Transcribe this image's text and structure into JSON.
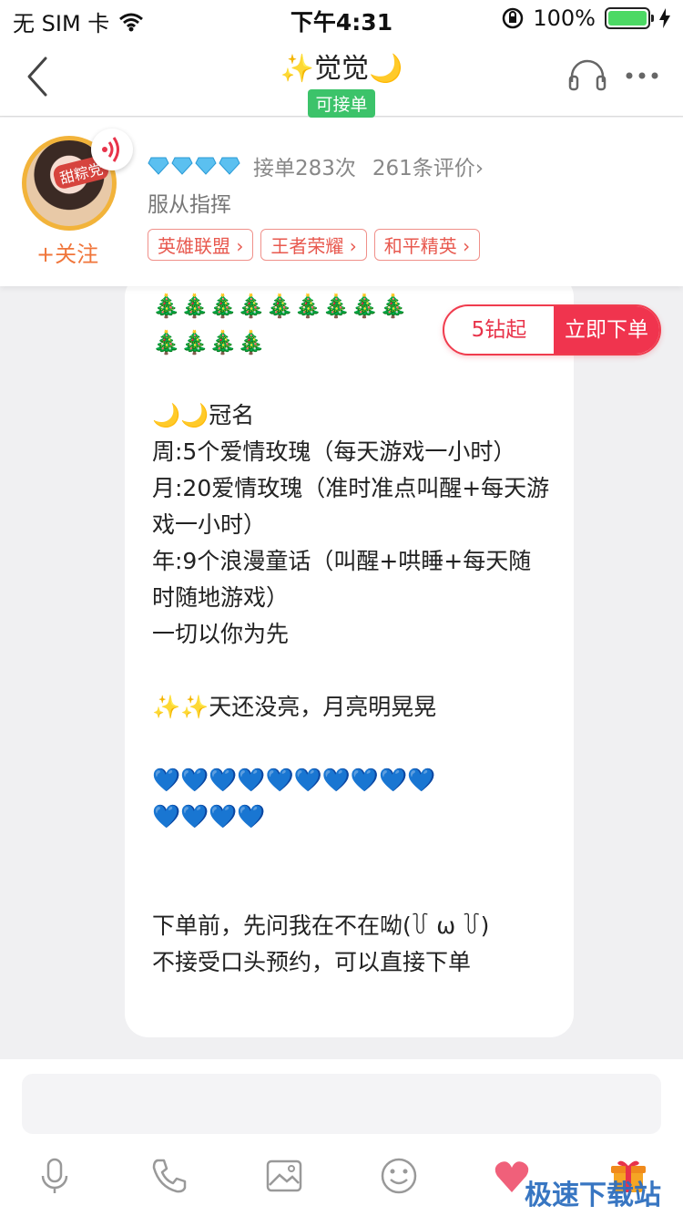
{
  "status_bar": {
    "carrier": "无 SIM 卡",
    "time": "下午4:31",
    "battery": "100%"
  },
  "nav": {
    "title": "✨觉觉🌙",
    "status_badge": "可接单"
  },
  "profile": {
    "avatar_badge": "甜粽党",
    "follow_label": "+关注",
    "order_count": "接单283次",
    "review_count": "261条评价",
    "subtitle": "服从指挥",
    "tags": [
      "英雄联盟",
      "王者荣耀",
      "和平精英"
    ]
  },
  "order_pill": {
    "price": "5钻起",
    "buy_label": "立即下单"
  },
  "message": {
    "text": "🎄🎄🎄🎄🎄🎄🎄🎄🎄\n🎄🎄🎄🎄\n\n🌙🌙冠名\n周:5个爱情玫瑰（每天游戏一小时）\n月:20爱情玫瑰（准时准点叫醒+每天游戏一小时）\n年:9个浪漫童话（叫醒+哄睡+每天随时随地游戏）\n一切以你为先\n\n✨✨天还没亮，月亮明晃晃\n\n💙💙💙💙💙💙💙💙💙💙\n💙💙💙💙\n\n\n下单前，先问我在不在呦(꒦ ω ꒦)\n不接受口头预约，可以直接下单"
  },
  "input": {
    "placeholder": ""
  },
  "watermark": "极速下载站",
  "colors": {
    "accent_red": "#f0344e",
    "status_green": "#3cc36a",
    "follow_orange": "#f0753a",
    "tag_red": "#e8584e"
  }
}
